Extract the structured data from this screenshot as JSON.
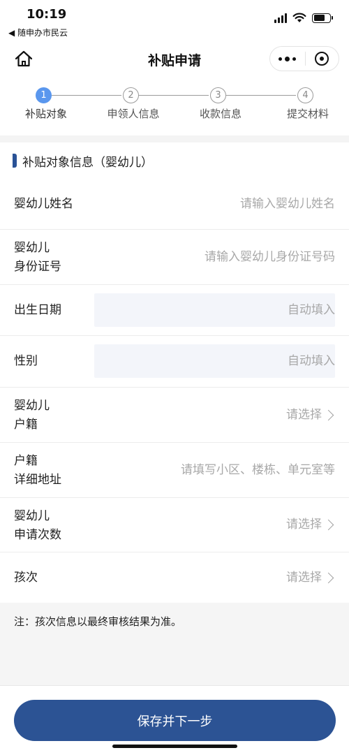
{
  "status_bar": {
    "time": "10:19",
    "back_app": "◀ 随申办市民云"
  },
  "nav": {
    "title": "补贴申请",
    "home_icon": "home-icon",
    "more_icon": "more-icon",
    "close_icon": "close-target-icon"
  },
  "steps": [
    {
      "number": "1",
      "label": "补贴对象",
      "active": true
    },
    {
      "number": "2",
      "label": "申领人信息",
      "active": false
    },
    {
      "number": "3",
      "label": "收款信息",
      "active": false
    },
    {
      "number": "4",
      "label": "提交材料",
      "active": false
    }
  ],
  "section": {
    "title": "补贴对象信息（婴幼儿）"
  },
  "form": {
    "rows": [
      {
        "label_lines": [
          "婴幼儿姓名"
        ],
        "value": "请输入婴幼儿姓名",
        "type": "input"
      },
      {
        "label_lines": [
          "婴幼儿",
          "身份证号"
        ],
        "value": "请输入婴幼儿身份证号码",
        "type": "input"
      },
      {
        "label_lines": [
          "出生日期"
        ],
        "value": "自动填入",
        "type": "auto"
      },
      {
        "label_lines": [
          "性别"
        ],
        "value": "自动填入",
        "type": "auto"
      },
      {
        "label_lines": [
          "婴幼儿",
          "户籍"
        ],
        "value": "请选择",
        "type": "select"
      },
      {
        "label_lines": [
          "户籍",
          "详细地址"
        ],
        "value": "请填写小区、楼栋、单元室等",
        "type": "input"
      },
      {
        "label_lines": [
          "婴幼儿",
          "申请次数"
        ],
        "value": "请选择",
        "type": "select"
      },
      {
        "label_lines": [
          "孩次"
        ],
        "value": "请选择",
        "type": "select"
      }
    ]
  },
  "note": {
    "text": "注：孩次信息以最终审核结果为准。"
  },
  "footer": {
    "submit_label": "保存并下一步"
  },
  "colors": {
    "primary": "#2c5394",
    "step_active": "#5a97ee",
    "placeholder": "#a8a8a8",
    "auto_fill_bg": "#f3f5fa"
  }
}
